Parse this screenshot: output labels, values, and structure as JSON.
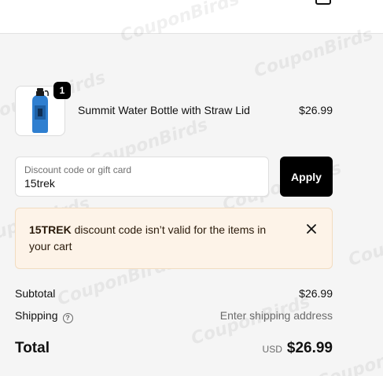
{
  "watermark": "CouponBirds",
  "header": {
    "cart_icon": "shopping-bag-icon"
  },
  "product": {
    "name": "Summit Water Bottle with Straw Lid",
    "price": "$26.99",
    "quantity": "1",
    "image_icon": "water-bottle-icon"
  },
  "discount": {
    "label": "Discount code or gift card",
    "value": "15trek",
    "apply_label": "Apply"
  },
  "error": {
    "code": "15TREK",
    "message": " discount code isn’t valid for the items in your cart",
    "close_icon": "close-icon"
  },
  "summary": {
    "subtotal_label": "Subtotal",
    "subtotal_value": "$26.99",
    "shipping_label": "Shipping",
    "shipping_help_icon": "question-circle-icon",
    "shipping_value": "Enter shipping address",
    "total_label": "Total",
    "currency": "USD",
    "total_value": "$26.99"
  }
}
